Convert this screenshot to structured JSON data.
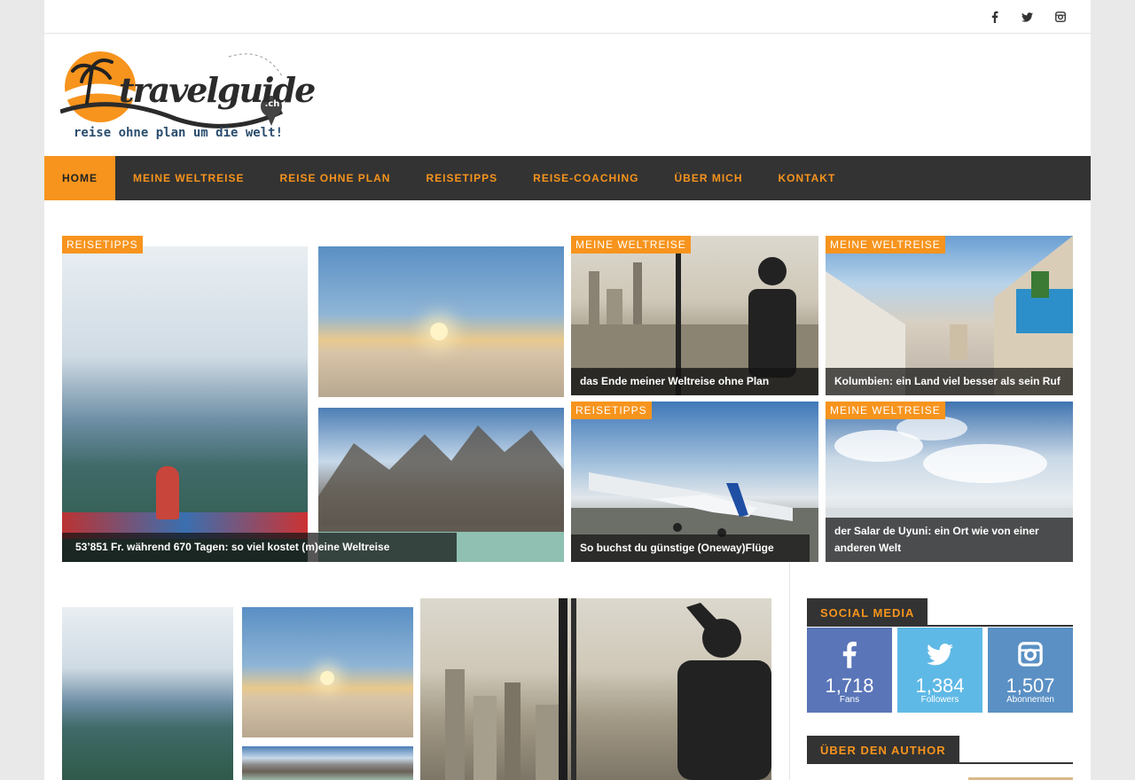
{
  "topbar": {
    "social": [
      {
        "icon": "facebook-icon",
        "glyph": "f"
      },
      {
        "icon": "twitter-icon",
        "glyph": "🐦"
      },
      {
        "icon": "instagram-icon",
        "glyph": "◎"
      }
    ]
  },
  "logo": {
    "wordmark": "travelguide",
    "suffix": ".ch",
    "tagline": "reise ohne plan um die welt!"
  },
  "nav": {
    "items": [
      {
        "label": "HOME",
        "active": true
      },
      {
        "label": "MEINE WELTREISE",
        "active": false
      },
      {
        "label": "REISE OHNE PLAN",
        "active": false
      },
      {
        "label": "REISETIPPS",
        "active": false
      },
      {
        "label": "REISE-COACHING",
        "active": false
      },
      {
        "label": "ÜBER MICH",
        "active": false
      },
      {
        "label": "KONTAKT",
        "active": false
      }
    ]
  },
  "featured": [
    {
      "category": "REISETIPPS",
      "title": "53’851 Fr. während 670 Tagen: so viel kostet (m)eine Weltreise"
    },
    {
      "category": "MEINE WELTREISE",
      "title": "das Ende meiner Weltreise ohne Plan"
    },
    {
      "category": "MEINE WELTREISE",
      "title": "Kolumbien: ein Land viel besser als sein Ruf"
    },
    {
      "category": "REISETIPPS",
      "title": "So buchst du günstige (Oneway)Flüge"
    },
    {
      "category": "MEINE WELTREISE",
      "title": "der Salar de Uyuni: ein Ort wie von einer anderen Welt"
    }
  ],
  "sidebar": {
    "social_title": "SOCIAL MEDIA",
    "social": [
      {
        "icon": "facebook-icon",
        "count": "1,718",
        "label": "Fans",
        "color": "#5a75b8"
      },
      {
        "icon": "twitter-icon",
        "count": "1,384",
        "label": "Followers",
        "color": "#5fb9e6"
      },
      {
        "icon": "instagram-icon",
        "count": "1,507",
        "label": "Abonnenten",
        "color": "#5a90c4"
      }
    ],
    "author_title": "ÜBER DEN AUTHOR"
  },
  "colors": {
    "accent": "#f7941d",
    "nav_bg": "#333333"
  }
}
